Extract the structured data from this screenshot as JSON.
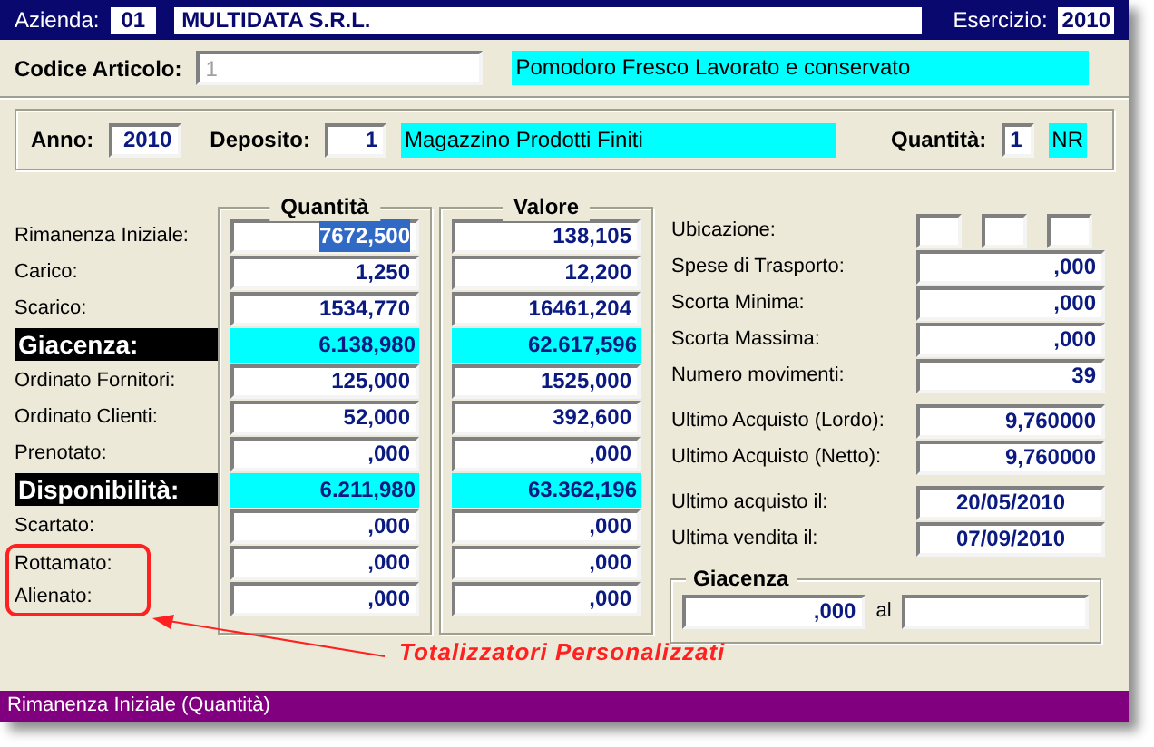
{
  "header": {
    "company_label": "Azienda:",
    "company_code": "01",
    "company_name": "MULTIDATA S.R.L.",
    "year_label": "Esercizio:",
    "year": "2010"
  },
  "article": {
    "label": "Codice Articolo:",
    "code": "1",
    "description": "Pomodoro Fresco Lavorato e conservato"
  },
  "filter": {
    "year_label": "Anno:",
    "year": "2010",
    "warehouse_label": "Deposito:",
    "warehouse_code": "1",
    "warehouse_name": "Magazzino Prodotti Finiti",
    "quantity_label": "Quantità:",
    "quantity": "1",
    "unit": "NR"
  },
  "totals": {
    "columns": [
      "Quantità",
      "Valore"
    ],
    "rows": [
      {
        "label": "Rimanenza Iniziale:",
        "kind": "normal",
        "quantity": "7672,500",
        "value": "138,105",
        "selected": true,
        "annotated": false
      },
      {
        "label": "Carico:",
        "kind": "normal",
        "quantity": "1,250",
        "value": "12,200",
        "selected": false,
        "annotated": false
      },
      {
        "label": "Scarico:",
        "kind": "normal",
        "quantity": "1534,770",
        "value": "16461,204",
        "selected": false,
        "annotated": false
      },
      {
        "label": "Giacenza:",
        "kind": "highlight",
        "quantity": "6.138,980",
        "value": "62.617,596",
        "selected": false,
        "annotated": false
      },
      {
        "label": "Ordinato Fornitori:",
        "kind": "normal",
        "quantity": "125,000",
        "value": "1525,000",
        "selected": false,
        "annotated": false
      },
      {
        "label": "Ordinato Clienti:",
        "kind": "normal",
        "quantity": "52,000",
        "value": "392,600",
        "selected": false,
        "annotated": false
      },
      {
        "label": "Prenotato:",
        "kind": "normal",
        "quantity": ",000",
        "value": ",000",
        "selected": false,
        "annotated": false
      },
      {
        "label": "Disponibilità:",
        "kind": "highlight",
        "quantity": "6.211,980",
        "value": "63.362,196",
        "selected": false,
        "annotated": false
      },
      {
        "label": "Scartato:",
        "kind": "normal",
        "quantity": ",000",
        "value": ",000",
        "selected": false,
        "annotated": false
      },
      {
        "label": "Rottamato:",
        "kind": "normal",
        "quantity": ",000",
        "value": ",000",
        "selected": false,
        "annotated": true
      },
      {
        "label": "Alienato:",
        "kind": "normal",
        "quantity": ",000",
        "value": ",000",
        "selected": false,
        "annotated": true
      }
    ]
  },
  "annotation": {
    "text": "Totalizzatori Personalizzati"
  },
  "details": {
    "sections": [
      [
        {
          "label": "Ubicazione:",
          "kind": "boxes"
        },
        {
          "label": "Spese di Trasporto:",
          "kind": "number",
          "value": ",000"
        },
        {
          "label": "Scorta Minima:",
          "kind": "number",
          "value": ",000"
        },
        {
          "label": "Scorta Massima:",
          "kind": "number",
          "value": ",000"
        },
        {
          "label": "Numero movimenti:",
          "kind": "number",
          "value": "39"
        }
      ],
      [
        {
          "label": "Ultimo Acquisto (Lordo):",
          "kind": "number",
          "value": "9,760000"
        },
        {
          "label": "Ultimo Acquisto (Netto):",
          "kind": "number",
          "value": "9,760000"
        }
      ],
      [
        {
          "label": "Ultimo acquisto il:",
          "kind": "date",
          "value": "20/05/2010"
        },
        {
          "label": "Ultima vendita il:",
          "kind": "date",
          "value": "07/09/2010"
        }
      ]
    ]
  },
  "stock_period": {
    "title": "Giacenza",
    "value": ",000",
    "connector": "al"
  },
  "status_bar": "Rimanenza Iniziale (Quantità)"
}
